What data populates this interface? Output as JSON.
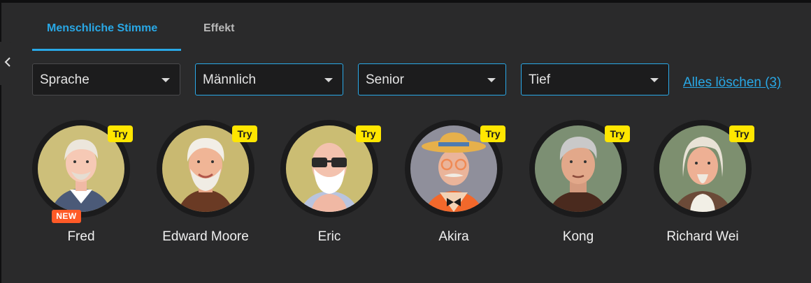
{
  "tabs": [
    {
      "label": "Menschliche Stimme",
      "active": true
    },
    {
      "label": "Effekt",
      "active": false
    }
  ],
  "filters": [
    {
      "label": "Sprache",
      "selected": false
    },
    {
      "label": "Männlich",
      "selected": true
    },
    {
      "label": "Senior",
      "selected": true
    },
    {
      "label": "Tief",
      "selected": true
    }
  ],
  "clear_all_label": "Alles löschen (3)",
  "try_label": "Try",
  "new_label": "NEW",
  "voices": [
    {
      "name": "Fred",
      "is_new": true,
      "bg": "#cdbf7a"
    },
    {
      "name": "Edward Moore",
      "is_new": false,
      "bg": "#c9b971"
    },
    {
      "name": "Eric",
      "is_new": false,
      "bg": "#cbbd73"
    },
    {
      "name": "Akira",
      "is_new": false,
      "bg": "#8f8f9b"
    },
    {
      "name": "Kong",
      "is_new": false,
      "bg": "#7c8f73"
    },
    {
      "name": "Richard Wei",
      "is_new": false,
      "bg": "#7d8f6f"
    }
  ],
  "colors": {
    "accent": "#29a8e6",
    "try_badge": "#ffe600",
    "new_badge": "#ff5a27"
  },
  "icons": {
    "collapse": "chevron-left-icon",
    "dropdown": "caret-down-icon"
  }
}
